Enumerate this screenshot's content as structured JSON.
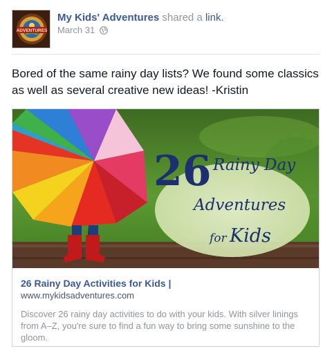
{
  "post": {
    "author": "My Kids' Adventures",
    "action_text": "shared a",
    "action_link": "link.",
    "date": "March 31",
    "privacy_icon": "globe-icon",
    "message": "Bored of the same rainy day lists? We found some classics as well as several creative new ideas! -Kristin"
  },
  "avatar": {
    "logo_text": "ADVENTURES"
  },
  "link_card": {
    "image": {
      "number": "26",
      "line1": "Rainy Day",
      "line2": "Adventures",
      "line3_small": "for",
      "line3_big": "Kids"
    },
    "title": "26 Rainy Day Activities for Kids |",
    "domain": "www.mykidsadventures.com",
    "description": "Discover 26 rainy day activities to do with your kids. With silver linings from A–Z, you're sure to find a fun way to bring some sunshine to the gloom."
  },
  "colors": {
    "link_blue": "#3b5998",
    "muted_gray": "#90949c"
  }
}
